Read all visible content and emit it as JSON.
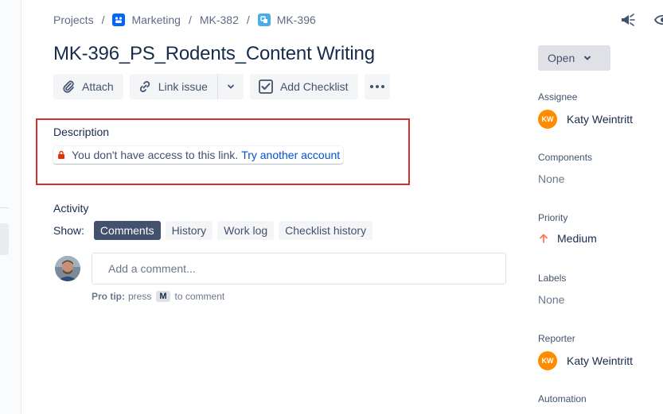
{
  "breadcrumb": {
    "projects": "Projects",
    "project": "Marketing",
    "parent": "MK-382",
    "issue": "MK-396",
    "separator": "/"
  },
  "issue": {
    "title": "MK-396_PS_Rodents_Content Writing"
  },
  "toolbar": {
    "attach_label": "Attach",
    "link_issue_label": "Link issue",
    "add_checklist_label": "Add Checklist"
  },
  "description": {
    "label": "Description",
    "no_access_text": "You don't have access to this link.",
    "try_another_account": "Try another account"
  },
  "activity": {
    "label": "Activity",
    "show_label": "Show:",
    "tabs": [
      {
        "label": "Comments",
        "active": true
      },
      {
        "label": "History",
        "active": false
      },
      {
        "label": "Work log",
        "active": false
      },
      {
        "label": "Checklist history",
        "active": false
      }
    ],
    "comment_placeholder": "Add a comment...",
    "protip_prefix": "Pro tip:",
    "protip_press": "press",
    "protip_key": "M",
    "protip_suffix": "to comment"
  },
  "sidebar": {
    "status": "Open",
    "assignee_label": "Assignee",
    "assignee": {
      "initials": "KW",
      "name": "Katy Weintritt"
    },
    "components_label": "Components",
    "components_value": "None",
    "priority_label": "Priority",
    "priority_value": "Medium",
    "labels_label": "Labels",
    "labels_value": "None",
    "reporter_label": "Reporter",
    "reporter": {
      "initials": "KW",
      "name": "Katy Weintritt"
    },
    "automation_label": "Automation"
  },
  "colors": {
    "accent": "#0052cc",
    "highlight_box": "#d0312d",
    "avatar_orange": "#ff8b00",
    "priority_medium": "#ff7452",
    "active_tab": "#42526e"
  }
}
